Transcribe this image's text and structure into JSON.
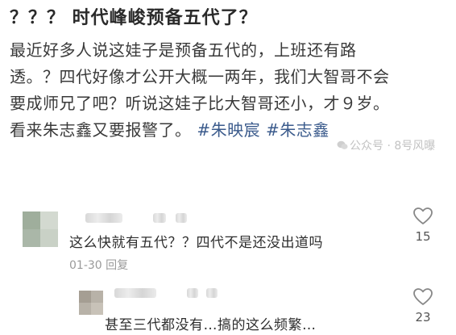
{
  "post": {
    "title": "？？？ 时代峰峻预备五代了？",
    "body_line1": "最近好多人说这娃子是预备五代的，上班还有路",
    "body_line2": "透。？四代好像才公开大概一两年，我们大智哥不会",
    "body_line3": "要成师兄了吧？听说这娃子比大智哥还小，才９岁。",
    "body_line4": "看来朱志鑫又要报警了。",
    "tag1": "#朱映宸",
    "tag2": "#朱志鑫"
  },
  "watermark": {
    "text": "公众号 · 8号风曝",
    "icon": "wechat-icon"
  },
  "comments": [
    {
      "text": "这么快就有五代？？四代不是还没出道吗",
      "date": "01-30",
      "reply_label": "回复",
      "likes": "15"
    },
    {
      "text": "甚至三代都没有…搞的这么频繁…",
      "likes": "23"
    }
  ],
  "colors": {
    "tag": "#3b5b8c",
    "meta": "#9a9a9a",
    "like_icon": "#888888"
  }
}
